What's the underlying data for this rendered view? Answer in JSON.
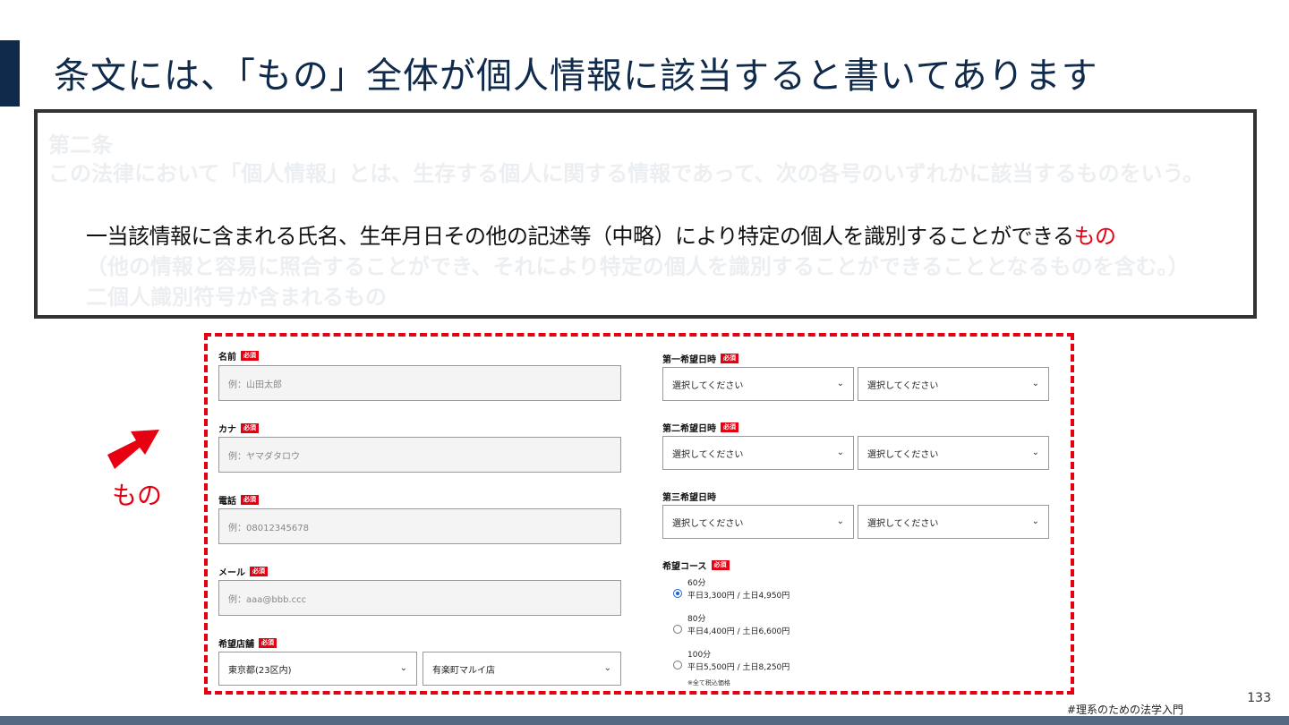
{
  "slide": {
    "title": "条文には、「もの」全体が個人情報に該当すると書いてあります",
    "page_number": "133",
    "hashtag": "#理系のための法学入門",
    "colors": {
      "title": "#0f2a4a",
      "accent": "#e60012",
      "footer_bar": "#546a82"
    }
  },
  "law_text": {
    "article": "第二条",
    "definition": "この法律において「個人情報」とは、生存する個人に関する情報であって、次の各号のいずれかに該当するものをいう。",
    "item1_main": "一当該情報に含まれる氏名、生年月日その他の記述等（中略）により特定の個人を識別することができる",
    "item1_highlight": "もの",
    "item1_sub": "（他の情報と容易に照合することができ、それにより特定の個人を識別することができることとなるものを含む。）",
    "item2": "二個人識別符号が含まれるもの"
  },
  "annotation": {
    "label": "もの",
    "icon": "arrow-icon"
  },
  "form": {
    "required_badge": "必須",
    "name": {
      "label": "名前",
      "placeholder": "例：山田太郎"
    },
    "kana": {
      "label": "カナ",
      "placeholder": "例：ヤマダタロウ"
    },
    "phone": {
      "label": "電話",
      "placeholder": "例：08012345678"
    },
    "email": {
      "label": "メール",
      "placeholder": "例：aaa@bbb.ccc"
    },
    "store": {
      "label": "希望店舗",
      "prefecture": "東京都(23区内)",
      "shop": "有楽町マルイ店"
    },
    "date1": {
      "label": "第一希望日時",
      "date": "選択してください",
      "time": "選択してください"
    },
    "date2": {
      "label": "第二希望日時",
      "date": "選択してください",
      "time": "選択してください"
    },
    "date3": {
      "label": "第三希望日時",
      "date": "選択してください",
      "time": "選択してください"
    },
    "course": {
      "label": "希望コース",
      "options": [
        {
          "duration": "60分",
          "price": "平日3,300円 / 土日4,950円",
          "selected": true
        },
        {
          "duration": "80分",
          "price": "平日4,400円 / 土日6,600円",
          "selected": false
        },
        {
          "duration": "100分",
          "price": "平日5,500円 / 土日8,250円",
          "selected": false
        }
      ],
      "note": "※全て税込価格"
    }
  }
}
